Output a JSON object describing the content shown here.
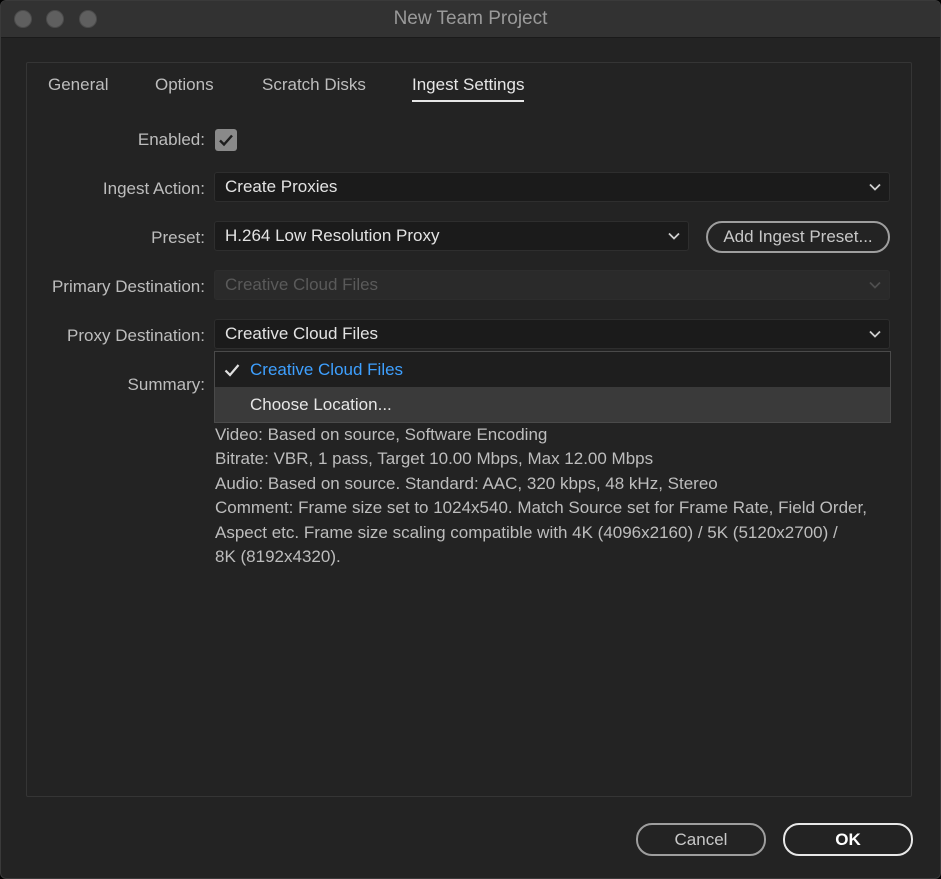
{
  "window": {
    "title": "New Team Project"
  },
  "tabs": [
    {
      "label": "General",
      "active": false
    },
    {
      "label": "Options",
      "active": false
    },
    {
      "label": "Scratch Disks",
      "active": false
    },
    {
      "label": "Ingest Settings",
      "active": true
    }
  ],
  "form": {
    "enabled_label": "Enabled:",
    "enabled_checked": true,
    "ingest_action_label": "Ingest Action:",
    "ingest_action_value": "Create Proxies",
    "preset_label": "Preset:",
    "preset_value": "H.264 Low Resolution Proxy",
    "add_preset_label": "Add Ingest Preset...",
    "primary_destination_label": "Primary Destination:",
    "primary_destination_value": "Creative Cloud Files",
    "proxy_destination_label": "Proxy Destination:",
    "proxy_destination_value": "Creative Cloud Files",
    "summary_label": "Summary:"
  },
  "dropdown": {
    "options": [
      {
        "label": "Creative Cloud Files",
        "selected": true
      },
      {
        "label": "Choose Location...",
        "selected": false
      }
    ]
  },
  "summary_lines": [
    "Video: Based on source, Software Encoding",
    "Bitrate: VBR, 1 pass, Target 10.00 Mbps, Max 12.00 Mbps",
    "Audio: Based on source. Standard: AAC, 320 kbps, 48 kHz, Stereo",
    "Comment: Frame size set to 1024x540. Match Source set for Frame Rate, Field Order,",
    "Aspect etc. Frame size scaling compatible with 4K (4096x2160) / 5K (5120x2700) /",
    "8K (8192x4320)."
  ],
  "buttons": {
    "cancel": "Cancel",
    "ok": "OK"
  },
  "colors": {
    "accent_blue": "#3ea0ff",
    "background": "#232323",
    "field": "#1b1b1b"
  }
}
